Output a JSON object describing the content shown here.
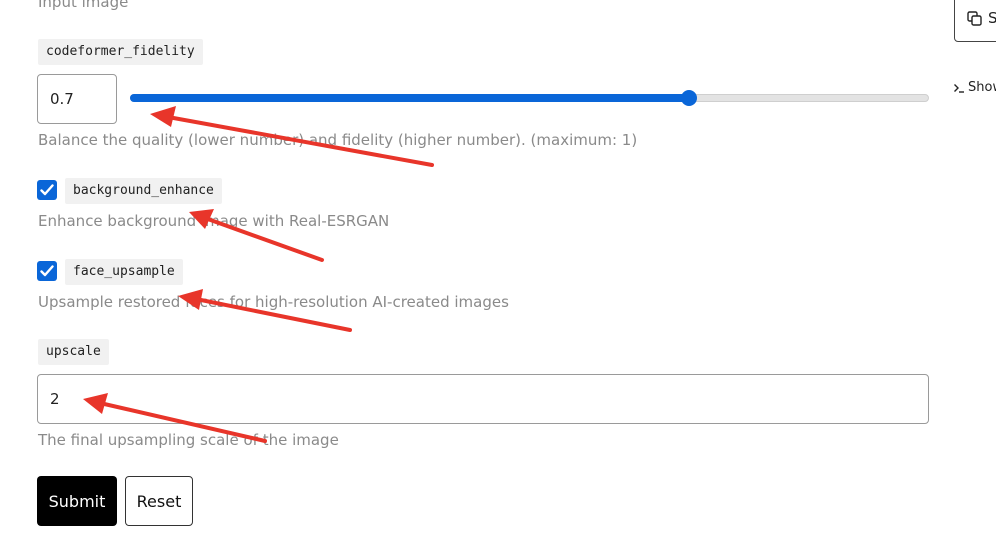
{
  "top_fragment": "Input image",
  "fields": {
    "codeformer_fidelity": {
      "label": "codeformer_fidelity",
      "value": "0.7",
      "slider_value": 0.7,
      "slider_max": 1,
      "help": "Balance the quality (lower number) and fidelity (higher number). (maximum: 1)"
    },
    "background_enhance": {
      "label": "background_enhance",
      "checked": true,
      "help": "Enhance background image with Real-ESRGAN"
    },
    "face_upsample": {
      "label": "face_upsample",
      "checked": true,
      "help": "Upsample restored faces for high-resolution AI-created images"
    },
    "upscale": {
      "label": "upscale",
      "value": "2",
      "help": "The final upsampling scale of the image"
    }
  },
  "buttons": {
    "submit": "Submit",
    "reset": "Reset"
  },
  "side": {
    "copy_button_label": "S",
    "show_label": "Show"
  },
  "colors": {
    "accent": "#0a66d8",
    "annotation_arrow": "#e8352a"
  }
}
